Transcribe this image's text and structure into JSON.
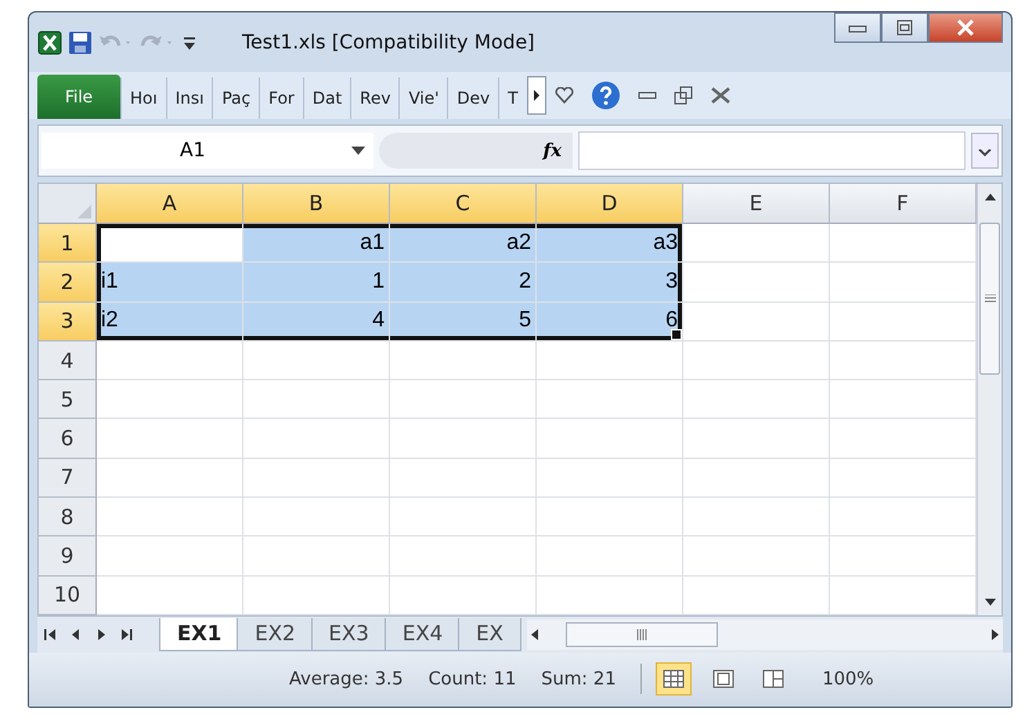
{
  "window": {
    "title": "Test1.xls  [Compatibility Mode]"
  },
  "ribbon": {
    "file_tab": "File",
    "tabs": [
      {
        "label": "Hoı",
        "selected": false
      },
      {
        "label": "Insı",
        "selected": false
      },
      {
        "label": "Paç",
        "selected": false
      },
      {
        "label": "For",
        "selected": false
      },
      {
        "label": "Dat",
        "selected": false
      },
      {
        "label": "Rev",
        "selected": false
      },
      {
        "label": "Vie'",
        "selected": false
      },
      {
        "label": "Dev",
        "selected": false
      },
      {
        "label": "T",
        "selected": false
      }
    ]
  },
  "formula_bar": {
    "name_box": "A1",
    "fx": "fx"
  },
  "columns": [
    {
      "label": "A",
      "selected": true
    },
    {
      "label": "B",
      "selected": true
    },
    {
      "label": "C",
      "selected": true
    },
    {
      "label": "D",
      "selected": true
    },
    {
      "label": "E",
      "selected": false
    },
    {
      "label": "F",
      "selected": false
    }
  ],
  "rows": [
    {
      "label": "1",
      "selected": true,
      "cells": [
        {
          "text": "",
          "selected": false
        },
        {
          "text": "a1",
          "selected": true
        },
        {
          "text": "a2",
          "selected": true
        },
        {
          "text": "a3",
          "selected": true
        }
      ]
    },
    {
      "label": "2",
      "selected": true,
      "cells": [
        {
          "text": "i1",
          "selected": true
        },
        {
          "text": "1",
          "selected": true
        },
        {
          "text": "2",
          "selected": true
        },
        {
          "text": "3",
          "selected": true
        }
      ]
    },
    {
      "label": "3",
      "selected": true,
      "cells": [
        {
          "text": "i2",
          "selected": true
        },
        {
          "text": "4",
          "selected": true
        },
        {
          "text": "5",
          "selected": true
        },
        {
          "text": "6",
          "selected": true
        }
      ]
    },
    {
      "label": "4",
      "selected": false,
      "cells": []
    },
    {
      "label": "5",
      "selected": false,
      "cells": []
    },
    {
      "label": "6",
      "selected": false,
      "cells": []
    },
    {
      "label": "7",
      "selected": false,
      "cells": []
    },
    {
      "label": "8",
      "selected": false,
      "cells": []
    },
    {
      "label": "9",
      "selected": false,
      "cells": []
    },
    {
      "label": "10",
      "selected": false,
      "cells": []
    }
  ],
  "sheet_tabs": [
    {
      "label": "EX1",
      "selected": true
    },
    {
      "label": "EX2",
      "selected": false
    },
    {
      "label": "EX3",
      "selected": false
    },
    {
      "label": "EX4",
      "selected": false
    },
    {
      "label": "EX",
      "selected": false
    }
  ],
  "status_bar": {
    "stats": [
      "Average: 3.5",
      "Count: 11",
      "Sum: 21"
    ],
    "views": [
      {
        "kind": "normal",
        "selected": true
      },
      {
        "kind": "layout",
        "selected": false
      },
      {
        "kind": "pagebreak",
        "selected": false
      }
    ],
    "zoom": "100%"
  }
}
